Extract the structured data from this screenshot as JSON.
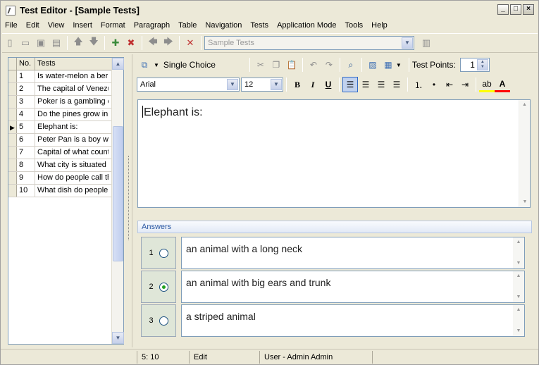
{
  "window": {
    "title": "Test Editor - [Sample Tests]",
    "buttons": [
      "_",
      "□",
      "×"
    ]
  },
  "menu": [
    "File",
    "Edit",
    "View",
    "Insert",
    "Format",
    "Paragraph",
    "Table",
    "Navigation",
    "Tests",
    "Application Mode",
    "Tools",
    "Help"
  ],
  "toolbar": {
    "test_set_select": "Sample Tests"
  },
  "test_list": {
    "headers": {
      "no": "No.",
      "tests": "Tests"
    },
    "rows": [
      {
        "no": "1",
        "text": "Is water-melon a berry"
      },
      {
        "no": "2",
        "text": "The capital of Venezu"
      },
      {
        "no": "3",
        "text": "Poker is a gambling ca"
      },
      {
        "no": "4",
        "text": "Do the pines grow in A"
      },
      {
        "no": "5",
        "text": "Elephant is:",
        "current": true
      },
      {
        "no": "6",
        "text": "Peter Pan is a boy wh"
      },
      {
        "no": "7",
        "text": "Capital of what countr"
      },
      {
        "no": "8",
        "text": "What city is situated ir"
      },
      {
        "no": "9",
        "text": "How do people call th"
      },
      {
        "no": "10",
        "text": "What dish do people p"
      }
    ]
  },
  "editor_toolbar": {
    "question_type": "Single Choice",
    "test_points_label": "Test Points:",
    "test_points_value": "1",
    "font_name": "Arial",
    "font_size": "12"
  },
  "question_text": "Elephant is:",
  "answers": {
    "header": "Answers",
    "items": [
      {
        "num": "1",
        "text": "an animal with a long neck",
        "selected": false
      },
      {
        "num": "2",
        "text": "an animal with big ears and trunk",
        "selected": true
      },
      {
        "num": "3",
        "text": "a striped animal",
        "selected": false
      }
    ]
  },
  "status": {
    "position": "5: 10",
    "mode": "Edit",
    "user": "User - Admin Admin"
  }
}
